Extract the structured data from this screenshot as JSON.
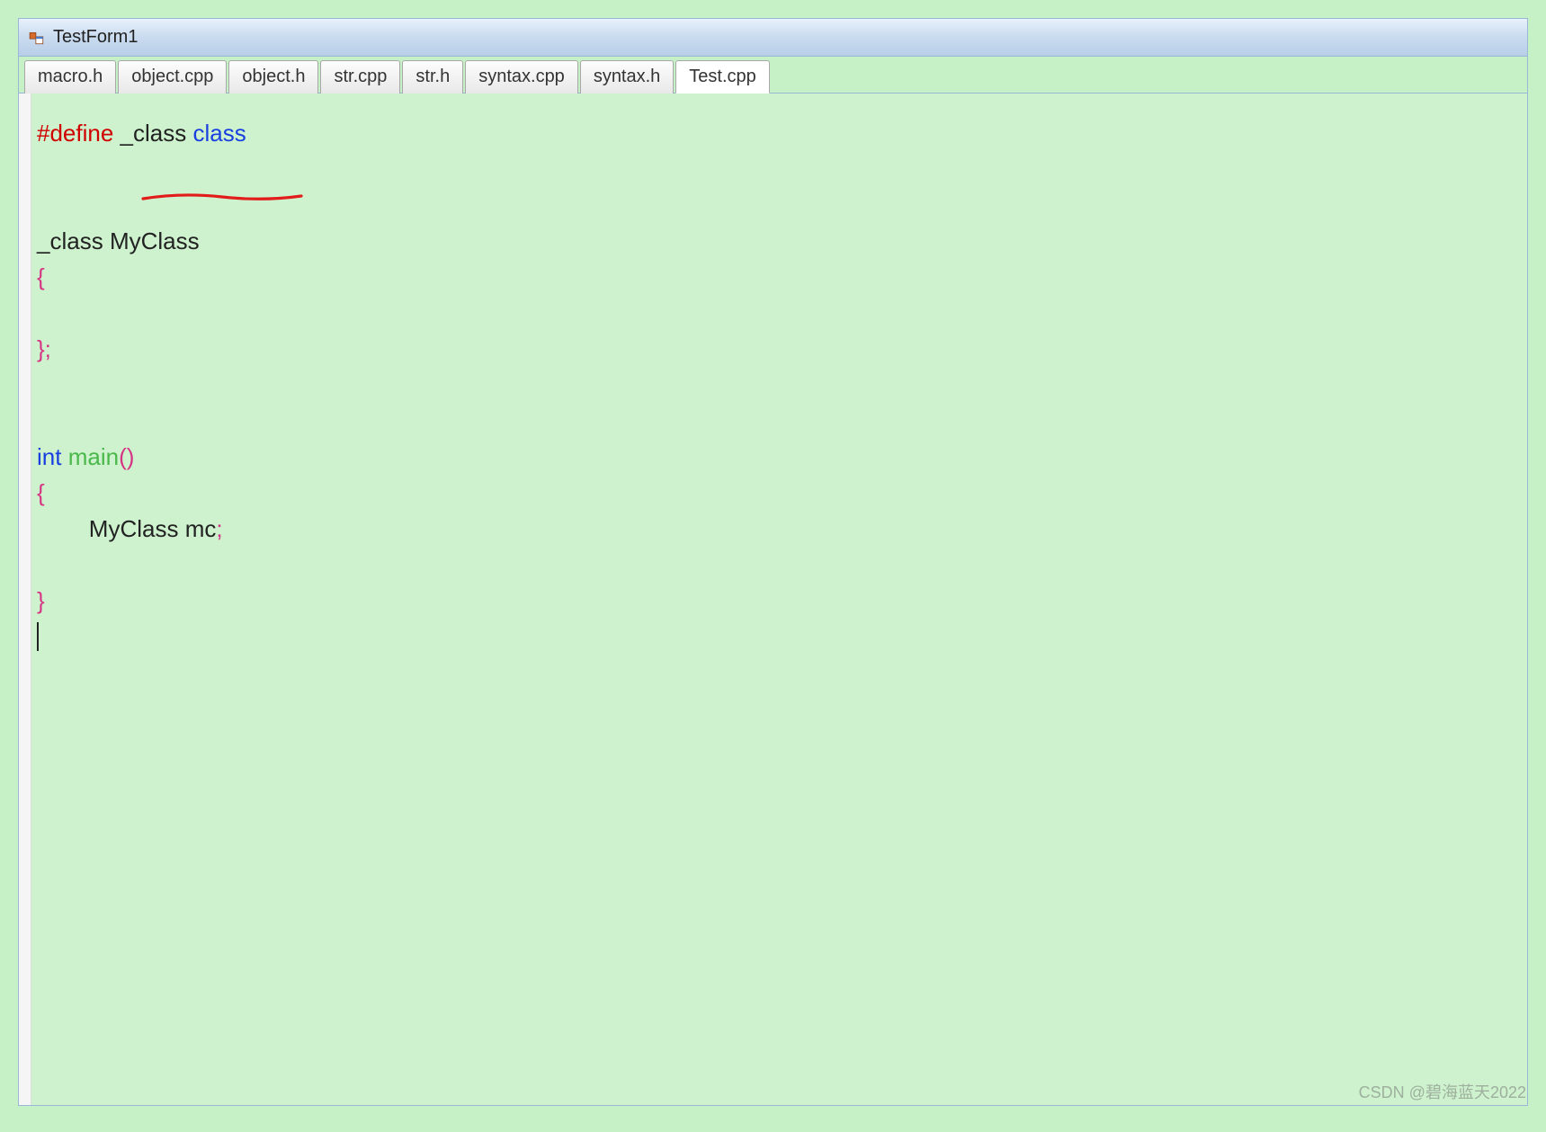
{
  "window": {
    "title": "TestForm1"
  },
  "tabs": [
    {
      "label": "macro.h",
      "active": false
    },
    {
      "label": "object.cpp",
      "active": false
    },
    {
      "label": "object.h",
      "active": false
    },
    {
      "label": "str.cpp",
      "active": false
    },
    {
      "label": "str.h",
      "active": false
    },
    {
      "label": "syntax.cpp",
      "active": false
    },
    {
      "label": "syntax.h",
      "active": false
    },
    {
      "label": "Test.cpp",
      "active": true
    }
  ],
  "code": {
    "line1": {
      "directive": "#define",
      "macro_name": "_class",
      "macro_value": "class"
    },
    "line2_blank": "",
    "line3_blank": "",
    "line4": {
      "class_kw": "_class",
      "class_name": "MyClass"
    },
    "line5": {
      "brace_open": "{"
    },
    "line6_blank": "",
    "line7": {
      "brace_close_semi": "};"
    },
    "line8_blank": "",
    "line9_blank": "",
    "line10": {
      "type": "int",
      "fn": "main",
      "parens": "()"
    },
    "line11": {
      "brace_open": "{"
    },
    "line12": {
      "indent": "        ",
      "var_type": "MyClass",
      "var_name": "mc",
      "semi": ";"
    },
    "line13_blank": "",
    "line14": {
      "brace_close": "}"
    },
    "line15_blank": ""
  },
  "watermark": "CSDN @碧海蓝天2022"
}
